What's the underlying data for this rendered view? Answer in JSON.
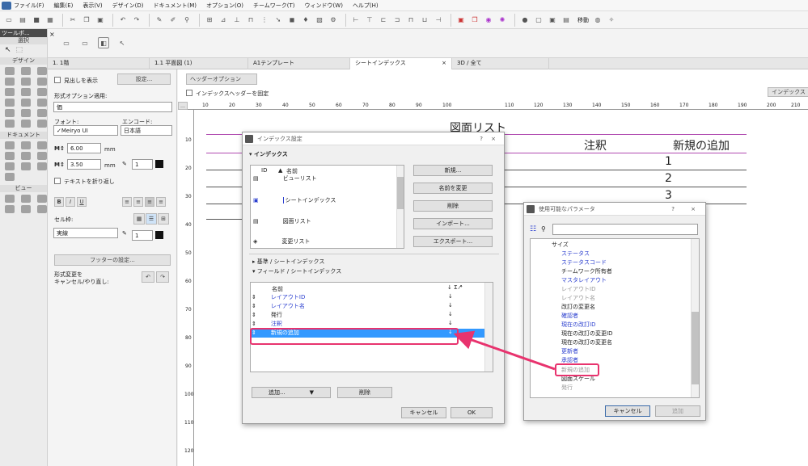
{
  "menu": {
    "items": [
      "ファイル(F)",
      "編集(E)",
      "表示(V)",
      "デザイン(D)",
      "ドキュメント(M)",
      "オプション(O)",
      "チームワーク(T)",
      "ウィンドウ(W)",
      "ヘルプ(H)"
    ],
    "morph_label": "移動"
  },
  "toolbox": {
    "title": "ツールボ...",
    "select_label": "選択",
    "design_label": "デザイン",
    "document_label": "ドキュメント",
    "view_label": "ビュー"
  },
  "tabs": [
    {
      "label": "1. 1階"
    },
    {
      "label": "1.1 平面図 (1)"
    },
    {
      "label": "A1テンプレート"
    },
    {
      "label": "シートインデックス",
      "close": "×"
    },
    {
      "label": "3D / 全て"
    }
  ],
  "left_panel": {
    "show_heading": "見出しを表示",
    "settings_btn": "設定...",
    "format_label": "形式オプション適用:",
    "format_value": "価",
    "font_label": "フォント:",
    "encode_label": "エンコード:",
    "font_value": "✓Meiryo UI",
    "encode_value": "日本語",
    "size1": "6.00",
    "size2": "3.50",
    "unit": "mm",
    "pen1": "1",
    "pen2": "1",
    "wrap_label": "テキストを折り返し",
    "bold": "B",
    "italic": "I",
    "underline": "U",
    "cell_frame_label": "セル枠:",
    "line_value": "実線",
    "footer_btn": "フッターの設定...",
    "undo_label_1": "形式変更を",
    "undo_label_2": "キャンセル/やり直し:"
  },
  "sheet": {
    "header_options": "ヘッダーオプション",
    "fix_header": "インデックスヘッダーを固定",
    "index_btn": "インデックス",
    "title": "図面リスト",
    "col_note": "注釈",
    "col_new": "新規の追加",
    "rows": [
      "1",
      "2",
      "3"
    ],
    "ruler_h": [
      "10",
      "20",
      "30",
      "40",
      "50",
      "60",
      "70",
      "80",
      "90",
      "100",
      "110",
      "120",
      "130",
      "140",
      "150",
      "160",
      "170",
      "180",
      "190",
      "200",
      "210"
    ],
    "ruler_v": [
      "10",
      "20",
      "30",
      "40",
      "50",
      "60",
      "70",
      "80",
      "90",
      "100",
      "110",
      "120"
    ]
  },
  "index_dialog": {
    "title": "インデックス設定",
    "help": "?",
    "close": "×",
    "section_index": "インデックス",
    "col_id": "ID",
    "col_name": "名前",
    "items": [
      {
        "name": "ビューリスト"
      },
      {
        "name": "シートインデックス"
      },
      {
        "name": "図面リスト"
      },
      {
        "name": "変更リスト"
      }
    ],
    "new_btn": "新規...",
    "rename_btn": "名前を変更",
    "delete_btn": "削除",
    "import_btn": "インポート...",
    "export_btn": "エクスポート...",
    "section_criteria": "基準 / シートインデックス",
    "section_fields": "フィールド / シートインデックス",
    "fields_header": "名前",
    "fields": [
      {
        "name": "レイアウトID"
      },
      {
        "name": "レイアウト名"
      },
      {
        "name": "発行"
      },
      {
        "name": "注釈"
      },
      {
        "name": "新規の追加"
      }
    ],
    "add_btn": "追加...",
    "remove_btn": "削除",
    "cancel_btn": "キャンセル",
    "ok_btn": "OK"
  },
  "params_dialog": {
    "title": "使用可能なパラメータ",
    "help": "?",
    "close": "×",
    "items": [
      {
        "label": "サイズ",
        "color": "normal"
      },
      {
        "label": "ステータス",
        "color": "blue"
      },
      {
        "label": "ステータスコード",
        "color": "blue"
      },
      {
        "label": "チームワーク所有者",
        "color": "normal"
      },
      {
        "label": "マスタレイアウト",
        "color": "blue"
      },
      {
        "label": "レイアウトID",
        "color": "grey"
      },
      {
        "label": "レイアウト名",
        "color": "grey"
      },
      {
        "label": "改訂の変更名",
        "color": "normal"
      },
      {
        "label": "確認者",
        "color": "blue"
      },
      {
        "label": "現在の改訂ID",
        "color": "blue"
      },
      {
        "label": "現在の改訂の変更ID",
        "color": "normal"
      },
      {
        "label": "現在の改訂の変更名",
        "color": "normal"
      },
      {
        "label": "更新者",
        "color": "blue"
      },
      {
        "label": "承認者",
        "color": "blue"
      },
      {
        "label": "新規の追加",
        "color": "grey"
      },
      {
        "label": "図面スケール",
        "color": "normal"
      },
      {
        "label": "発行",
        "color": "grey"
      }
    ],
    "cancel_btn": "キャンセル",
    "add_btn": "追加"
  },
  "colors": {
    "highlight": "#3399ff",
    "callout": "#e8336e",
    "accent_blue": "#2b3fcf"
  }
}
